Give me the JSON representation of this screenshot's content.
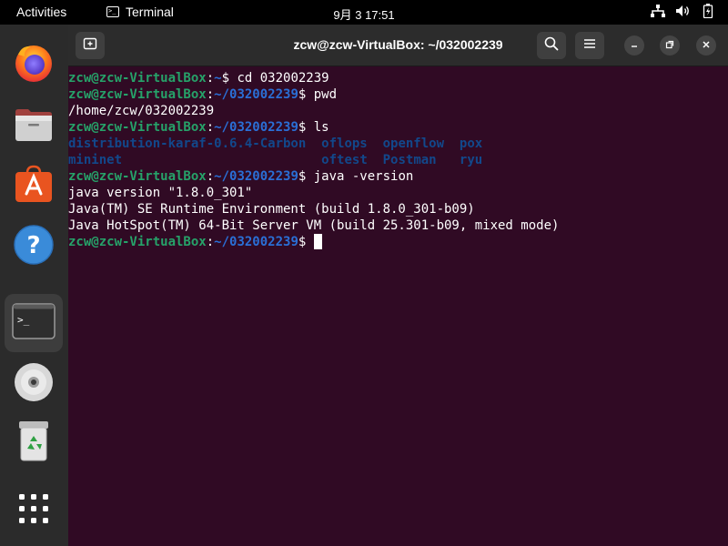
{
  "topbar": {
    "activities": "Activities",
    "app_name": "Terminal",
    "app_icon_glyph": ">_",
    "clock": "9月 3  17:51",
    "tray_icons": [
      "network-icon",
      "volume-icon",
      "battery-icon"
    ]
  },
  "dock": {
    "items": [
      {
        "name": "firefox",
        "icon": "firefox-icon"
      },
      {
        "name": "files",
        "icon": "files-icon"
      },
      {
        "name": "ubuntu-software",
        "icon": "software-icon"
      },
      {
        "name": "help",
        "icon": "help-icon"
      },
      {
        "name": "terminal",
        "icon": "terminal-icon",
        "active": true,
        "prompt_glyph": ">_"
      },
      {
        "name": "optical-drive",
        "icon": "cd-icon"
      },
      {
        "name": "trash",
        "icon": "trash-icon"
      },
      {
        "name": "show-applications",
        "icon": "app-grid-icon"
      }
    ],
    "help_glyph": "?"
  },
  "window": {
    "title": "zcw@zcw-VirtualBox: ~/032002239"
  },
  "terminal": {
    "user_host": "zcw@zcw-VirtualBox",
    "colon": ":",
    "path_home": "~",
    "path_dir": "~/032002239",
    "prompt_suffix": "$ ",
    "cmd_cd": "cd 032002239",
    "cmd_pwd": "pwd",
    "out_pwd": "/home/zcw/032002239",
    "cmd_ls": "ls",
    "ls_row1": [
      "distribution-karaf-0.6.4-Carbon",
      "oflops",
      "openflow",
      "pox"
    ],
    "ls_row2": [
      "mininet",
      "oftest",
      "Postman",
      "ryu"
    ],
    "cmd_java": "java -version",
    "java_out": [
      "java version \"1.8.0_301\"",
      "Java(TM) SE Runtime Environment (build 1.8.0_301-b09)",
      "Java HotSpot(TM) 64-Bit Server VM (build 25.301-b09, mixed mode)"
    ]
  },
  "colors": {
    "terminal_bg": "#300a24",
    "prompt_user": "#26a269",
    "prompt_path": "#2a6fd6",
    "directory": "#12488b",
    "ubuntu_orange": "#e95420"
  }
}
